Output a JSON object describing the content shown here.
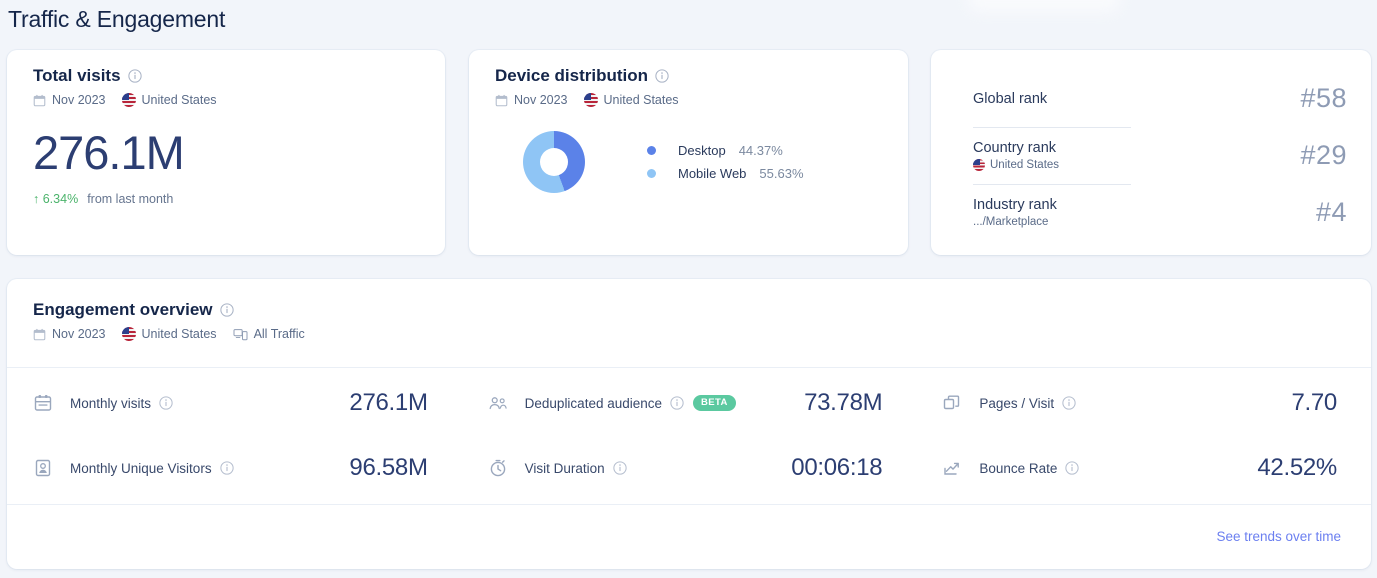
{
  "page": {
    "title": "Traffic & Engagement"
  },
  "colors": {
    "background": "#f2f5fa",
    "card": "#ffffff",
    "accent": "#6b7ff0",
    "value_text": "#2c3e72",
    "positive": "#4bb36b",
    "beta_badge": "#5bc9a0",
    "desktop": "#5b82e8",
    "mobile_web": "#8fc5f5"
  },
  "total_visits": {
    "title": "Total visits",
    "info_icon": "info-icon",
    "calendar_icon": "calendar-icon",
    "period": "Nov 2023",
    "flag_icon": "us-flag-icon",
    "country": "United States",
    "value": "276.1M",
    "delta_arrow": "↑",
    "delta": "6.34%",
    "delta_note": "from last month"
  },
  "device_distribution": {
    "title": "Device distribution",
    "info_icon": "info-icon",
    "calendar_icon": "calendar-icon",
    "period": "Nov 2023",
    "flag_icon": "us-flag-icon",
    "country": "United States",
    "legend": [
      {
        "label": "Desktop",
        "value": "44.37%",
        "color": "#5b82e8"
      },
      {
        "label": "Mobile Web",
        "value": "55.63%",
        "color": "#8fc5f5"
      }
    ]
  },
  "ranks": [
    {
      "label": "Global rank",
      "sub": "",
      "has_flag": false,
      "value": "#58"
    },
    {
      "label": "Country rank",
      "sub": "United States",
      "has_flag": true,
      "value": "#29"
    },
    {
      "label": "Industry rank",
      "sub": ".../Marketplace",
      "has_flag": false,
      "value": "#4"
    }
  ],
  "engagement": {
    "title": "Engagement overview",
    "info_icon": "info-icon",
    "calendar_icon": "calendar-icon",
    "period": "Nov 2023",
    "flag_icon": "us-flag-icon",
    "country": "United States",
    "devices_icon": "devices-icon",
    "traffic": "All Traffic",
    "columns": [
      [
        {
          "icon": "calendar-metric-icon",
          "label": "Monthly visits",
          "value": "276.1M",
          "beta": false
        },
        {
          "icon": "visitor-card-icon",
          "label": "Monthly Unique Visitors",
          "value": "96.58M",
          "beta": false
        }
      ],
      [
        {
          "icon": "people-icon",
          "label": "Deduplicated audience",
          "value": "73.78M",
          "beta": true,
          "badge": "BETA"
        },
        {
          "icon": "clock-icon",
          "label": "Visit Duration",
          "value": "00:06:18",
          "beta": false
        }
      ],
      [
        {
          "icon": "pages-stack-icon",
          "label": "Pages / Visit",
          "value": "7.70",
          "beta": false
        },
        {
          "icon": "bounce-arrow-icon",
          "label": "Bounce Rate",
          "value": "42.52%",
          "beta": false
        }
      ]
    ],
    "trends_link": "See trends over time"
  }
}
